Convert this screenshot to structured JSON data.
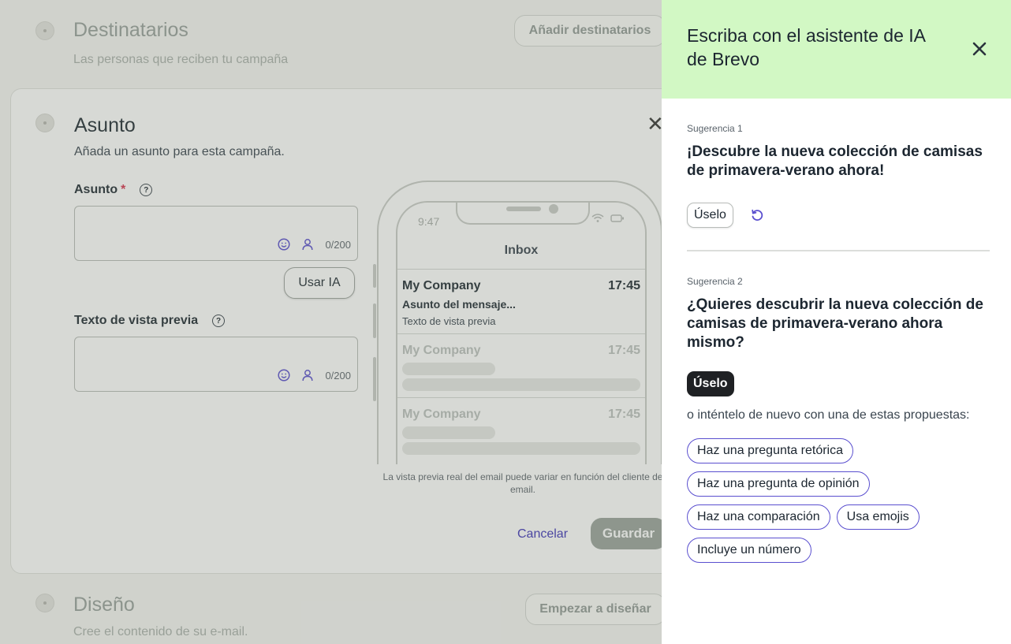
{
  "sections": {
    "destinatarios": {
      "title": "Destinatarios",
      "subtitle": "Las personas que reciben tu campaña",
      "button": "Añadir destinatarios"
    },
    "diseno": {
      "title": "Diseño",
      "subtitle": "Cree el contenido de su e-mail.",
      "button": "Empezar a diseñar"
    }
  },
  "asunto_card": {
    "title": "Asunto",
    "subtitle": "Añada un asunto para esta campaña.",
    "subject_label": "Asunto",
    "required_mark": "*",
    "subject_value": "",
    "subject_counter": "0/200",
    "use_ai_button": "Usar IA",
    "preview_label": "Texto de vista previa",
    "preview_value": "",
    "preview_counter": "0/200",
    "cancel": "Cancelar",
    "save": "Guardar",
    "phone_note": "La vista previa real del email puede variar en función del cliente de email."
  },
  "phone": {
    "time": "9:47",
    "inbox_title": "Inbox",
    "mails": [
      {
        "name": "My Company",
        "time": "17:45",
        "subject": "Asunto del mensaje...",
        "preview": "Texto de vista previa"
      },
      {
        "name": "My Company",
        "time": "17:45"
      },
      {
        "name": "My Company",
        "time": "17:45"
      }
    ]
  },
  "drawer": {
    "title": "Escriba con el asistente de IA de Brevo",
    "header_color": "#d2f8c4",
    "suggestions": [
      {
        "label": "Sugerencia 1",
        "text": "¡Descubre la nueva colección de camisas de primavera-verano ahora!",
        "use_label": "Úselo"
      },
      {
        "label": "Sugerencia 2",
        "text": "¿Quieres descubrir la nueva colección de camisas de primavera-verano ahora mismo?",
        "use_label": "Úselo"
      }
    ],
    "retry_text": "o inténtelo de nuevo con una de estas propuestas:",
    "chips": [
      "Haz una pregunta retórica",
      "Haz una pregunta de opinión",
      "Haz una comparación",
      "Usa emojis",
      "Incluye un número"
    ]
  }
}
